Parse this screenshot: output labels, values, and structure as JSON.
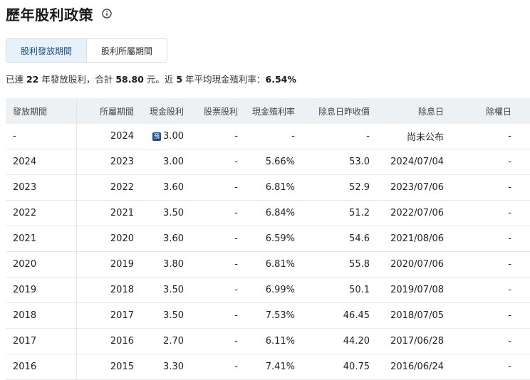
{
  "header": {
    "title": "歷年股利政策",
    "info_icon": "info-icon"
  },
  "tabs": [
    {
      "label": "股利發放期間",
      "active": true
    },
    {
      "label": "股利所屬期間",
      "active": false
    }
  ],
  "summary": {
    "p1": "已連 ",
    "years": "22",
    "p2": " 年發放股利，合計 ",
    "total": "58.80",
    "p3": " 元。近 ",
    "recent": "5",
    "p4": " 年平均現金殖利率：",
    "avg_yield": "6.54%"
  },
  "table": {
    "columns": [
      "發放期間",
      "所屬期間",
      "現金股利",
      "股票股利",
      "現金殖利率",
      "除息日昨收價",
      "除息日",
      "除權日"
    ],
    "badge": "預",
    "rows": [
      [
        "-",
        "2024",
        "3.00",
        "-",
        "-",
        "-",
        "尚未公布",
        "-"
      ],
      [
        "2024",
        "2023",
        "3.00",
        "-",
        "5.66%",
        "53.0",
        "2024/07/04",
        "-"
      ],
      [
        "2023",
        "2022",
        "3.60",
        "-",
        "6.81%",
        "52.9",
        "2023/07/06",
        "-"
      ],
      [
        "2022",
        "2021",
        "3.50",
        "-",
        "6.84%",
        "51.2",
        "2022/07/06",
        "-"
      ],
      [
        "2021",
        "2020",
        "3.60",
        "-",
        "6.59%",
        "54.6",
        "2021/08/06",
        "-"
      ],
      [
        "2020",
        "2019",
        "3.80",
        "-",
        "6.81%",
        "55.8",
        "2020/07/06",
        "-"
      ],
      [
        "2019",
        "2018",
        "3.50",
        "-",
        "6.99%",
        "50.1",
        "2019/07/08",
        "-"
      ],
      [
        "2018",
        "2017",
        "3.50",
        "-",
        "7.53%",
        "46.45",
        "2018/07/05",
        "-"
      ],
      [
        "2017",
        "2016",
        "2.70",
        "-",
        "6.11%",
        "44.20",
        "2017/06/28",
        "-"
      ],
      [
        "2016",
        "2015",
        "3.30",
        "-",
        "7.41%",
        "40.75",
        "2016/06/24",
        "-"
      ]
    ]
  }
}
